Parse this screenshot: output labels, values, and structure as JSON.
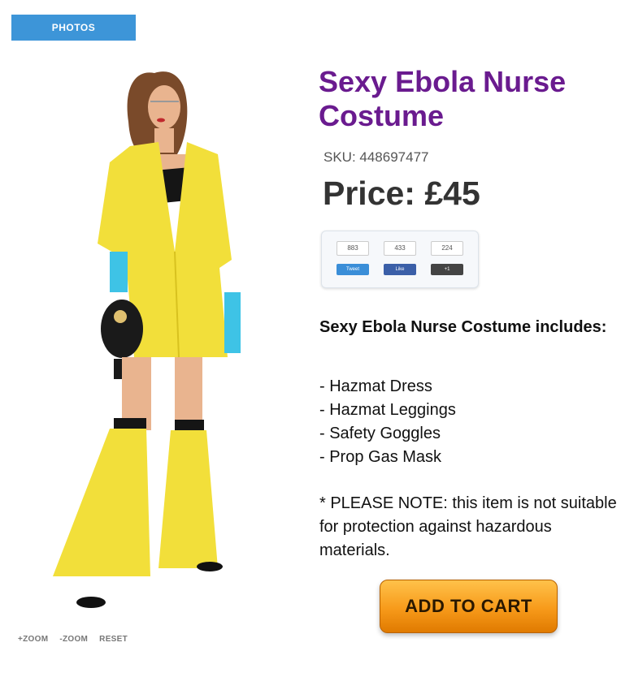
{
  "tabs": {
    "photos": "PHOTOS"
  },
  "zoom": {
    "zoom_in": "+ZOOM",
    "zoom_out": "-ZOOM",
    "reset": "RESET"
  },
  "product": {
    "title": "Sexy Ebola Nurse Costume",
    "sku": "SKU: 448697477",
    "price": "Price:  £45",
    "includes_heading": "Sexy Ebola Nurse Costume includes:",
    "items": [
      "- Hazmat Dress",
      "- Hazmat Leggings",
      "- Safety Goggles",
      "- Prop Gas Mask"
    ],
    "note": "* PLEASE NOTE: this item is not suitable for protection against hazardous materials."
  },
  "social": {
    "buttons": [
      {
        "count": "883",
        "label": "Tweet",
        "color": "#3a8ed8"
      },
      {
        "count": "433",
        "label": "Like",
        "color": "#3b5fa8"
      },
      {
        "count": "224",
        "label": "+1",
        "color": "#444444"
      }
    ]
  },
  "cart": {
    "label": "ADD TO CART"
  },
  "colors": {
    "title": "#6a1b8f",
    "tab": "#3d95d8",
    "cart": "#f79a1a"
  }
}
